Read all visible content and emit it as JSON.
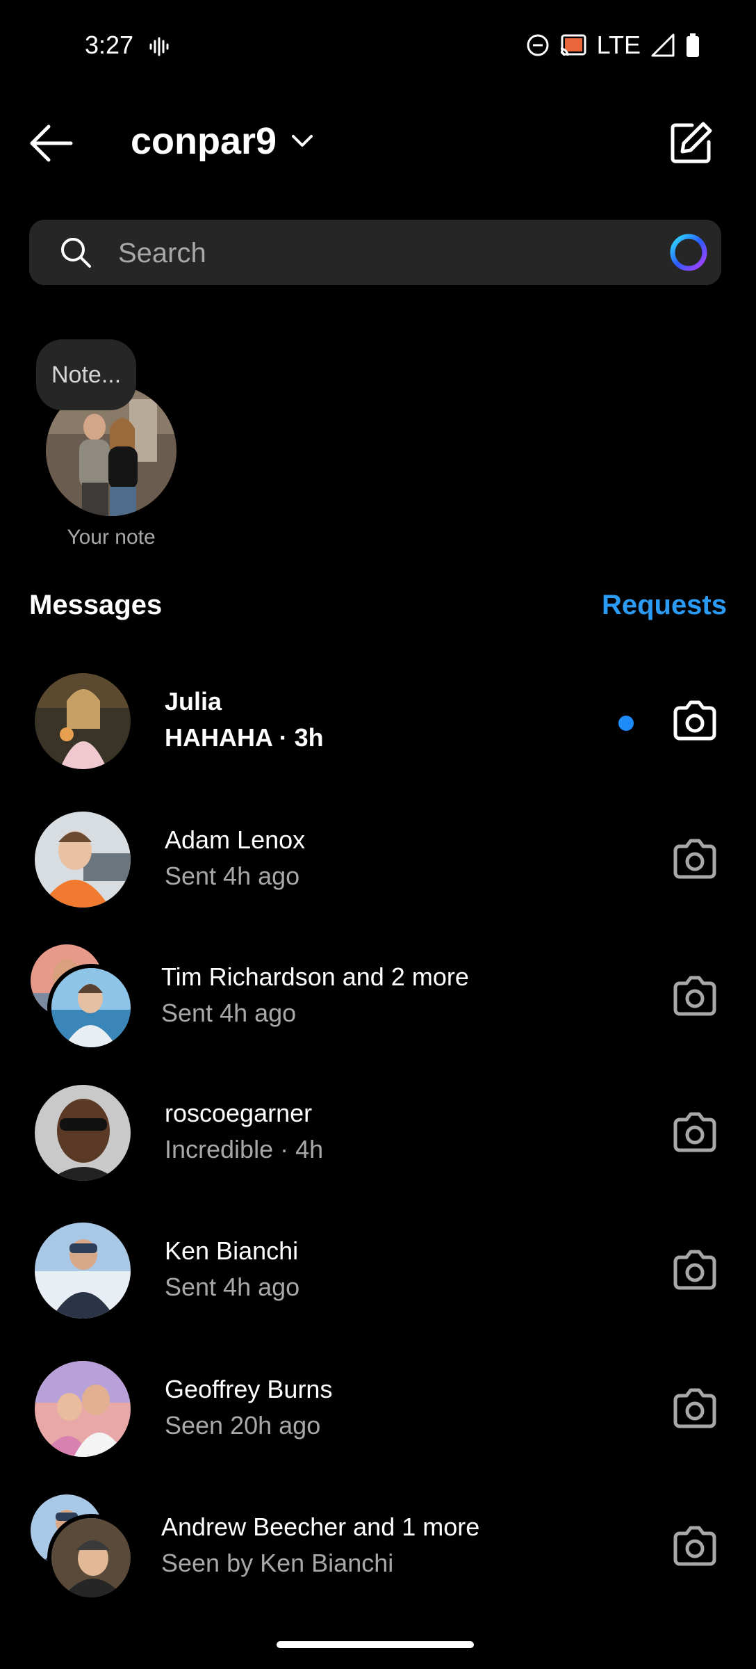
{
  "status": {
    "time": "3:27",
    "network": "LTE"
  },
  "header": {
    "username": "conpar9"
  },
  "search": {
    "placeholder": "Search"
  },
  "note": {
    "bubble_text": "Note...",
    "label": "Your note"
  },
  "section": {
    "title": "Messages",
    "requests": "Requests"
  },
  "colors": {
    "accent": "#2b9bf4",
    "unread_dot": "#1d8cf8",
    "background": "#000000",
    "surface": "#262626"
  },
  "conversations": [
    {
      "name": "Julia",
      "subtitle": "HAHAHA · 3h",
      "unread": true
    },
    {
      "name": "Adam Lenox",
      "subtitle": "Sent 4h ago",
      "unread": false
    },
    {
      "name": "Tim Richardson and 2 more",
      "subtitle": "Sent 4h ago",
      "unread": false,
      "group": true
    },
    {
      "name": "roscoegarner",
      "subtitle": "Incredible · 4h",
      "unread": false
    },
    {
      "name": "Ken Bianchi",
      "subtitle": "Sent 4h ago",
      "unread": false
    },
    {
      "name": "Geoffrey Burns",
      "subtitle": "Seen 20h ago",
      "unread": false
    },
    {
      "name": "Andrew Beecher and 1 more",
      "subtitle": "Seen by Ken Bianchi",
      "unread": false,
      "group": true
    }
  ],
  "icons": [
    "vibrate-icon",
    "do-not-disturb-icon",
    "cast-icon",
    "signal-icon",
    "battery-icon",
    "back-arrow-icon",
    "chevron-down-icon",
    "compose-icon",
    "search-icon",
    "ai-ring-icon",
    "camera-icon"
  ]
}
